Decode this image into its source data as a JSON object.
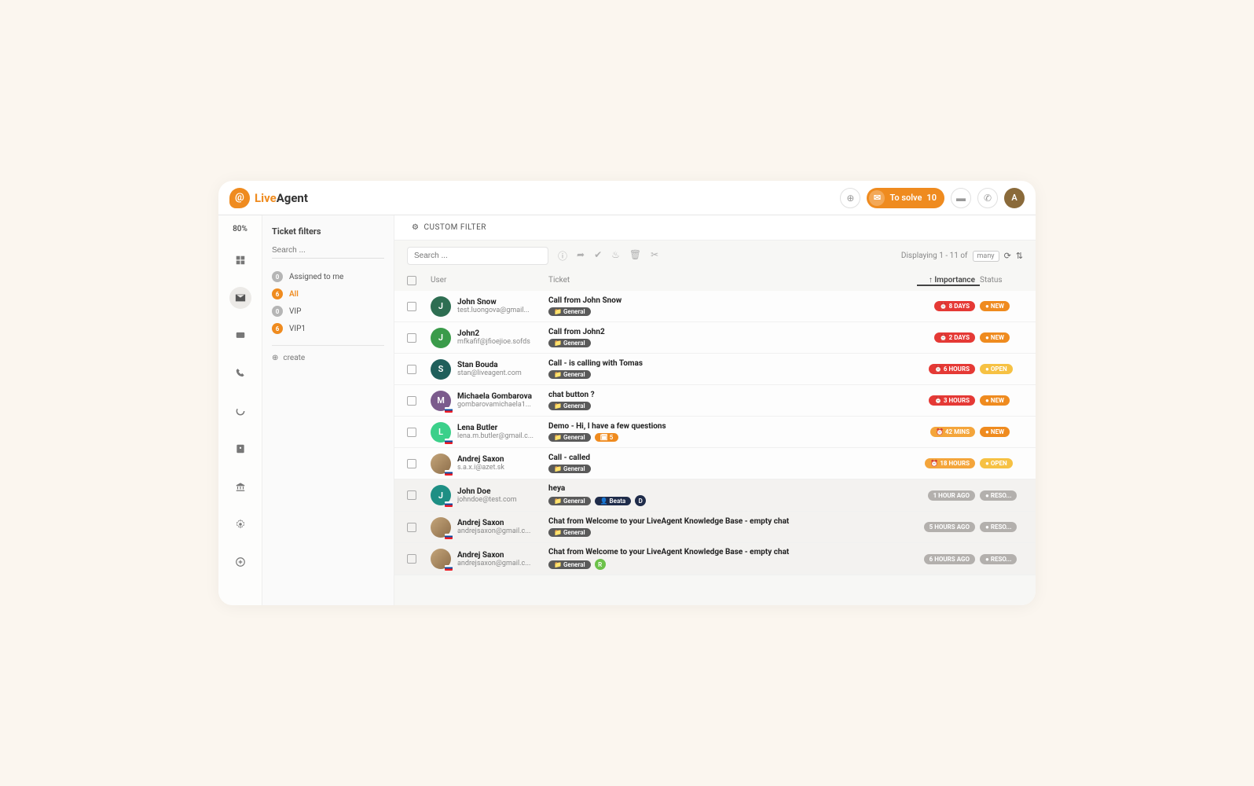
{
  "brand": {
    "live": "Live",
    "agent": "Agent"
  },
  "header": {
    "to_solve_label": "To solve",
    "to_solve_count": "10",
    "avatar_letter": "A"
  },
  "zoom": "80%",
  "filters": {
    "title": "Ticket filters",
    "search_placeholder": "Search ...",
    "items": [
      {
        "count": "0",
        "label": "Assigned to me",
        "dot": "gray"
      },
      {
        "count": "6",
        "label": "All",
        "dot": "orange",
        "active": true
      },
      {
        "count": "0",
        "label": "VIP",
        "dot": "gray"
      },
      {
        "count": "6",
        "label": "VIP1",
        "dot": "orange"
      }
    ],
    "create_label": "create"
  },
  "topbar": {
    "custom_filter": "CUSTOM FILTER",
    "search_placeholder": "Search ...",
    "displaying_prefix": "Displaying 1 - 11 of",
    "many": "many"
  },
  "columns": {
    "user": "User",
    "ticket": "Ticket",
    "importance": "Importance",
    "status": "Status"
  },
  "rows": [
    {
      "avatar": {
        "letter": "J",
        "bg": "#2e6e52"
      },
      "name": "John Snow",
      "email": "test.luongova@gmail...",
      "title": "Call from John Snow",
      "tags": [
        {
          "type": "general",
          "text": "General"
        }
      ],
      "importance": {
        "text": "8 DAYS",
        "style": "pill-red",
        "clock": true
      },
      "status": {
        "text": "NEW",
        "style": "pill-orange-solid"
      }
    },
    {
      "avatar": {
        "letter": "J",
        "bg": "#3a9b4a"
      },
      "name": "John2",
      "email": "mfkafif@jfioejioe.sofds",
      "title": "Call from John2",
      "tags": [
        {
          "type": "general",
          "text": "General"
        }
      ],
      "importance": {
        "text": "2 DAYS",
        "style": "pill-red",
        "clock": true
      },
      "status": {
        "text": "NEW",
        "style": "pill-orange-solid"
      }
    },
    {
      "avatar": {
        "letter": "S",
        "bg": "#1f5f5b"
      },
      "name": "Stan Bouda",
      "email": "stan@liveagent.com",
      "title": "Call - is calling with Tomas",
      "tags": [
        {
          "type": "general",
          "text": "General"
        }
      ],
      "importance": {
        "text": "6 HOURS",
        "style": "pill-red",
        "clock": true
      },
      "status": {
        "text": "OPEN",
        "style": "pill-yellow"
      }
    },
    {
      "avatar": {
        "letter": "M",
        "bg": "#7b5b8c",
        "flag": true
      },
      "name": "Michaela Gombarova",
      "email": "gombarovamichaela1...",
      "title": "chat button ?",
      "tags": [
        {
          "type": "general",
          "text": "General"
        }
      ],
      "importance": {
        "text": "3 HOURS",
        "style": "pill-red",
        "clock": true
      },
      "status": {
        "text": "NEW",
        "style": "pill-orange-solid"
      }
    },
    {
      "avatar": {
        "letter": "L",
        "bg": "#3bd08a",
        "flag": true
      },
      "name": "Lena Butler",
      "email": "lena.m.butler@gmail.c...",
      "title": "Demo - Hi, I have a few questions",
      "tags": [
        {
          "type": "general",
          "text": "General"
        },
        {
          "type": "orange",
          "text": "🗓 5"
        }
      ],
      "importance": {
        "text": "42 MINS",
        "style": "pill-orange-soft",
        "clock": true
      },
      "status": {
        "text": "NEW",
        "style": "pill-orange-solid"
      }
    },
    {
      "avatar": {
        "img": true,
        "flag": true
      },
      "name": "Andrej Saxon",
      "email": "s.a.x.i@azet.sk",
      "title": "Call - called",
      "tags": [
        {
          "type": "general",
          "text": "General"
        }
      ],
      "importance": {
        "text": "18 HOURS",
        "style": "pill-orange-soft",
        "clock": true
      },
      "status": {
        "text": "OPEN",
        "style": "pill-yellow"
      }
    },
    {
      "muted": true,
      "avatar": {
        "letter": "J",
        "bg": "#1e8f84",
        "flag": true
      },
      "name": "John Doe",
      "email": "johndoe@test.com",
      "title": "heya",
      "tags": [
        {
          "type": "general",
          "text": "General"
        },
        {
          "type": "navy",
          "text": "👤 Beata"
        },
        {
          "type": "d",
          "text": "D"
        }
      ],
      "importance": {
        "text": "1 HOUR AGO",
        "style": "pill-gray"
      },
      "status": {
        "text": "RESO...",
        "style": "pill-gray"
      }
    },
    {
      "muted": true,
      "avatar": {
        "img": true,
        "flag": true
      },
      "name": "Andrej Saxon",
      "email": "andrejsaxon@gmail.c...",
      "title": "Chat from Welcome to your LiveAgent Knowledge Base - empty chat",
      "tags": [
        {
          "type": "general",
          "text": "General"
        }
      ],
      "importance": {
        "text": "5 HOURS AGO",
        "style": "pill-gray"
      },
      "status": {
        "text": "RESO...",
        "style": "pill-gray"
      }
    },
    {
      "muted": true,
      "avatar": {
        "img": true,
        "flag": true
      },
      "name": "Andrej Saxon",
      "email": "andrejsaxon@gmail.c...",
      "title": "Chat from Welcome to your LiveAgent Knowledge Base - empty chat",
      "tags": [
        {
          "type": "general",
          "text": "General"
        },
        {
          "type": "green",
          "text": "R"
        }
      ],
      "importance": {
        "text": "6 HOURS AGO",
        "style": "pill-gray"
      },
      "status": {
        "text": "RESO...",
        "style": "pill-gray"
      }
    }
  ],
  "nav_icons": [
    "dashboard",
    "mail",
    "chat",
    "phone",
    "loading",
    "contacts",
    "bank",
    "settings",
    "plus"
  ]
}
